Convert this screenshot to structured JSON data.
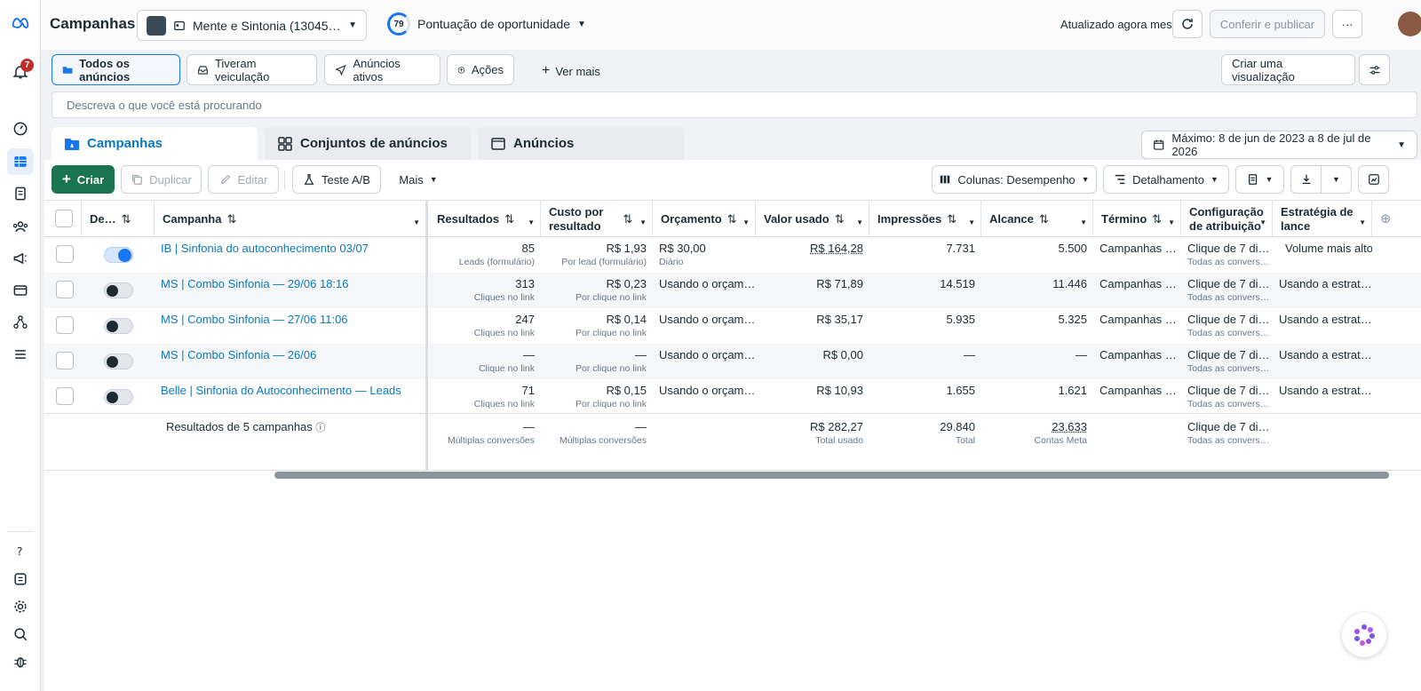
{
  "header": {
    "title": "Campanhas",
    "account_name": "Mente e Sintonia (13045…",
    "opportunity_score": "79",
    "opportunity_label": "Pontuação de oportunidade",
    "updated_label": "Atualizado agora mesmo",
    "publish_label": "Conferir e publicar",
    "more_label": "···"
  },
  "nav": {
    "notification_count": "7"
  },
  "filters": {
    "chips": [
      "Todos os anúncios",
      "Tiveram veiculação",
      "Anúncios ativos",
      "Ações"
    ],
    "see_more": "Ver mais",
    "create_view": "Criar uma visualização"
  },
  "search": {
    "placeholder": "Descreva o que você está procurando"
  },
  "level_tabs": [
    "Campanhas",
    "Conjuntos de anúncios",
    "Anúncios"
  ],
  "date_range": "Máximo: 8 de jun de 2023 a 8 de jul de 2026",
  "toolbar": {
    "create": "Criar",
    "duplicate": "Duplicar",
    "edit": "Editar",
    "ab_test": "Teste A/B",
    "more": "Mais",
    "columns": "Colunas: Desempenho",
    "breakdown": "Detalhamento"
  },
  "table": {
    "headers": {
      "delivery": "De…",
      "campaign": "Campanha",
      "results": "Resultados",
      "cost_per_result_1": "Custo por",
      "cost_per_result_2": "resultado",
      "budget": "Orçamento",
      "spent": "Valor usado",
      "impressions": "Impressões",
      "reach": "Alcance",
      "end": "Término",
      "attribution_1": "Configuração",
      "attribution_2": "de atribuição",
      "bid_1": "Estratégia de",
      "bid_2": "lance"
    },
    "rows": [
      {
        "name": "IB | Sinfonia do autoconhecimento 03/07",
        "active": true,
        "results": "85",
        "results_sub": "Leads (formulário)",
        "cost": "R$ 1,93",
        "cost_sub": "Por lead (formulário)",
        "budget": "R$ 30,00",
        "budget_sub": "Diário",
        "spent": "R$ 164,28",
        "impressions": "7.731",
        "reach": "5.500",
        "end": "Campanhas …",
        "attribution": "Clique de 7 di…",
        "attribution_sub": "Todas as convers…",
        "bid": "Volume mais alto"
      },
      {
        "name": "MS | Combo Sinfonia — 29/06 18:16",
        "active": false,
        "results": "313",
        "results_sub": "Cliques no link",
        "cost": "R$ 0,23",
        "cost_sub": "Por clique no link",
        "budget": "Usando o orçam…",
        "budget_sub": "",
        "spent": "R$ 71,89",
        "impressions": "14.519",
        "reach": "11.446",
        "end": "Campanhas …",
        "attribution": "Clique de 7 di…",
        "attribution_sub": "Todas as convers…",
        "bid": "Usando a estrat…"
      },
      {
        "name": "MS | Combo Sinfonia — 27/06 11:06",
        "active": false,
        "results": "247",
        "results_sub": "Cliques no link",
        "cost": "R$ 0,14",
        "cost_sub": "Por clique no link",
        "budget": "Usando o orçam…",
        "budget_sub": "",
        "spent": "R$ 35,17",
        "impressions": "5.935",
        "reach": "5.325",
        "end": "Campanhas …",
        "attribution": "Clique de 7 di…",
        "attribution_sub": "Todas as convers…",
        "bid": "Usando a estrat…"
      },
      {
        "name": "MS | Combo Sinfonia — 26/06",
        "active": false,
        "results": "—",
        "results_sub": "Clique no link",
        "cost": "—",
        "cost_sub": "Por clique no link",
        "budget": "Usando o orçam…",
        "budget_sub": "",
        "spent": "R$ 0,00",
        "impressions": "—",
        "reach": "—",
        "end": "Campanhas …",
        "attribution": "Clique de 7 di…",
        "attribution_sub": "Todas as convers…",
        "bid": "Usando a estrat…"
      },
      {
        "name": "Belle | Sinfonia do Autoconhecimento — Leads",
        "active": false,
        "results": "71",
        "results_sub": "Cliques no link",
        "cost": "R$ 0,15",
        "cost_sub": "Por clique no link",
        "budget": "Usando o orçam…",
        "budget_sub": "",
        "spent": "R$ 10,93",
        "impressions": "1.655",
        "reach": "1.621",
        "end": "Campanhas …",
        "attribution": "Clique de 7 di…",
        "attribution_sub": "Todas as convers…",
        "bid": "Usando a estrat…"
      }
    ],
    "totals": {
      "label": "Resultados de 5 campanhas",
      "results": "—",
      "results_sub": "Múltiplas conversões",
      "cost": "—",
      "cost_sub": "Múltiplas conversões",
      "spent": "R$ 282,27",
      "spent_sub": "Total usado",
      "impressions": "29.840",
      "impressions_sub": "Total",
      "reach": "23.633",
      "reach_sub": "Contas Meta",
      "attribution": "Clique de 7 di…",
      "attribution_sub": "Todas as convers…"
    }
  },
  "colors": {
    "accent": "#1877f2",
    "primary_button": "#1b7451",
    "link": "#0a78be"
  }
}
